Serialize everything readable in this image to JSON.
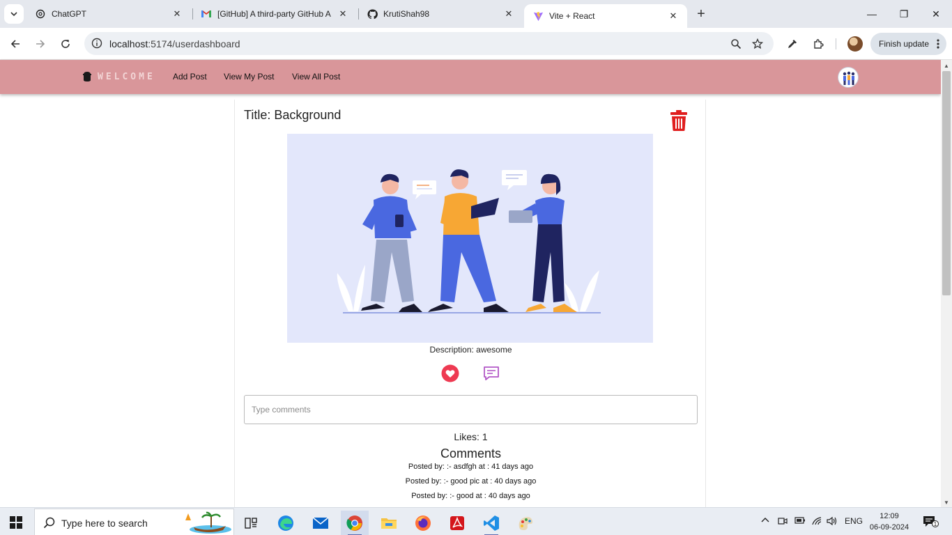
{
  "browser": {
    "tabs": [
      {
        "title": "ChatGPT",
        "active": false
      },
      {
        "title": "[GitHub] A third-party GitHub A",
        "active": false
      },
      {
        "title": "KrutiShah98",
        "active": false
      },
      {
        "title": "Vite + React",
        "active": true
      }
    ],
    "close_glyph": "✕",
    "new_tab_glyph": "+",
    "window_controls": {
      "minimize": "—",
      "restore": "❐",
      "close": "✕"
    },
    "url_host": "localhost",
    "url_path": ":5174/userdashboard",
    "finish_update_label": "Finish update"
  },
  "navbar": {
    "brand": "WELCOME",
    "links": [
      "Add Post",
      "View My Post",
      "View All Post"
    ]
  },
  "post": {
    "title": "Title: Background",
    "description": "Description: awesome",
    "comment_placeholder": "Type comments",
    "likes": "Likes: 1",
    "comments_heading": "Comments",
    "comments": [
      "Posted by: :- asdfgh at : 41 days ago",
      "Posted by: :- good pic at : 40 days ago",
      "Posted by: :- good at : 40 days ago"
    ]
  },
  "taskbar": {
    "search_placeholder": "Type here to search",
    "language": "ENG",
    "time": "12:09",
    "date": "06-09-2024",
    "notification_count": "1"
  },
  "colors": {
    "navbar": "#d9969a",
    "trash": "#e01e1e",
    "heart": "#ee3a52",
    "comment_icon": "#b257c7",
    "image_bg": "#e3e7fb"
  },
  "icons": [
    "chatgpt-icon",
    "gmail-icon",
    "github-icon",
    "vite-icon",
    "trash-icon",
    "heart-icon",
    "comment-icon",
    "windows-start-icon",
    "search-icon"
  ]
}
